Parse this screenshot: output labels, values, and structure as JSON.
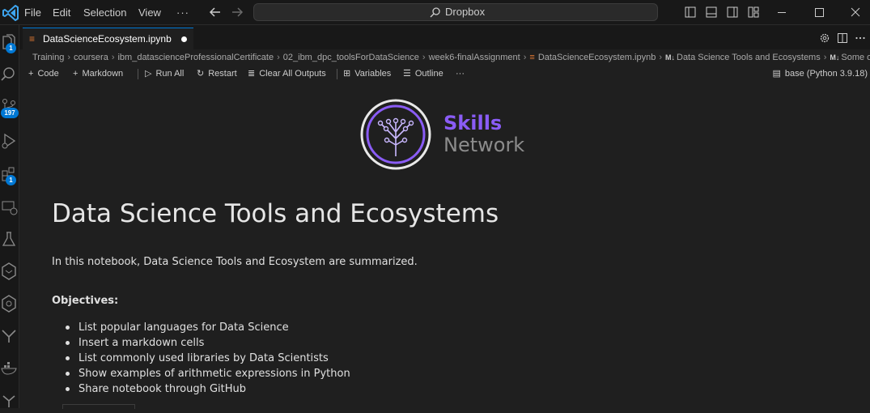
{
  "menu": {
    "items": [
      "File",
      "Edit",
      "Selection",
      "View"
    ],
    "more": "···"
  },
  "command_center": {
    "label": "Dropbox"
  },
  "activity_badges": {
    "explorer": "1",
    "source_control": "197",
    "extensions": "1"
  },
  "tab": {
    "title": "DataScienceEcosystem.ipynb",
    "unsaved": true
  },
  "breadcrumb": {
    "items": [
      "Training",
      "coursera",
      "ibm_datascienceProfessionalCertificate",
      "02_ibm_dpc_toolsForDataScience",
      "week6-finalAssignment",
      "DataScienceEcosystem.ipynb",
      "Data Science Tools and Ecosystems",
      "Some of the"
    ],
    "md_icon": "M↓"
  },
  "toolbar": {
    "code": "Code",
    "markdown": "Markdown",
    "run_all": "Run All",
    "restart": "Restart",
    "clear_outputs": "Clear All Outputs",
    "variables": "Variables",
    "outline": "Outline",
    "more": "···",
    "kernel": "base (Python 3.9.18)"
  },
  "logo": {
    "line1": "Skills",
    "line2": "Network",
    "accent": "#8a5cf6"
  },
  "notebook": {
    "title": "Data Science Tools and Ecosystems",
    "intro": "In this notebook, Data Science Tools and Ecosystem are summarized.",
    "objectives_heading": "Objectives:",
    "objectives": [
      "List popular languages for Data Science",
      "Insert a markdown cells",
      "List commonly used libraries by Data Scientists",
      "Show examples of arithmetic expressions in Python",
      "Share notebook through GitHub"
    ]
  },
  "colors": {
    "accent": "#0078d4",
    "notebook_icon": "#e37933",
    "background": "#1f1f1f"
  }
}
